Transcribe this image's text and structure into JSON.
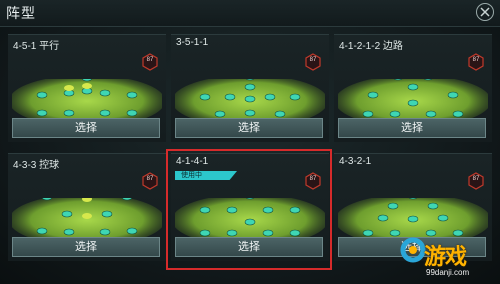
{
  "header": {
    "title": "阵型"
  },
  "select_label": "选择",
  "in_use_label": "使用中",
  "formations": [
    {
      "name": "4-5-1 平行",
      "rating": "87",
      "selected": false
    },
    {
      "name": "3-5-1-1",
      "rating": "87",
      "selected": false
    },
    {
      "name": "4-1-2-1-2 边路",
      "rating": "87",
      "selected": false
    },
    {
      "name": "4-3-3 控球",
      "rating": "87",
      "selected": false
    },
    {
      "name": "4-1-4-1",
      "rating": "87",
      "selected": true
    },
    {
      "name": "4-3-2-1",
      "rating": "87",
      "selected": false
    }
  ],
  "watermark": {
    "brand": "游戏",
    "url": "99danji.com"
  },
  "colors": {
    "accent": "#2cc7cc",
    "selected_border": "#d62b2b",
    "player_dot": "#3fd6b3",
    "pitch": "#8ac536"
  }
}
